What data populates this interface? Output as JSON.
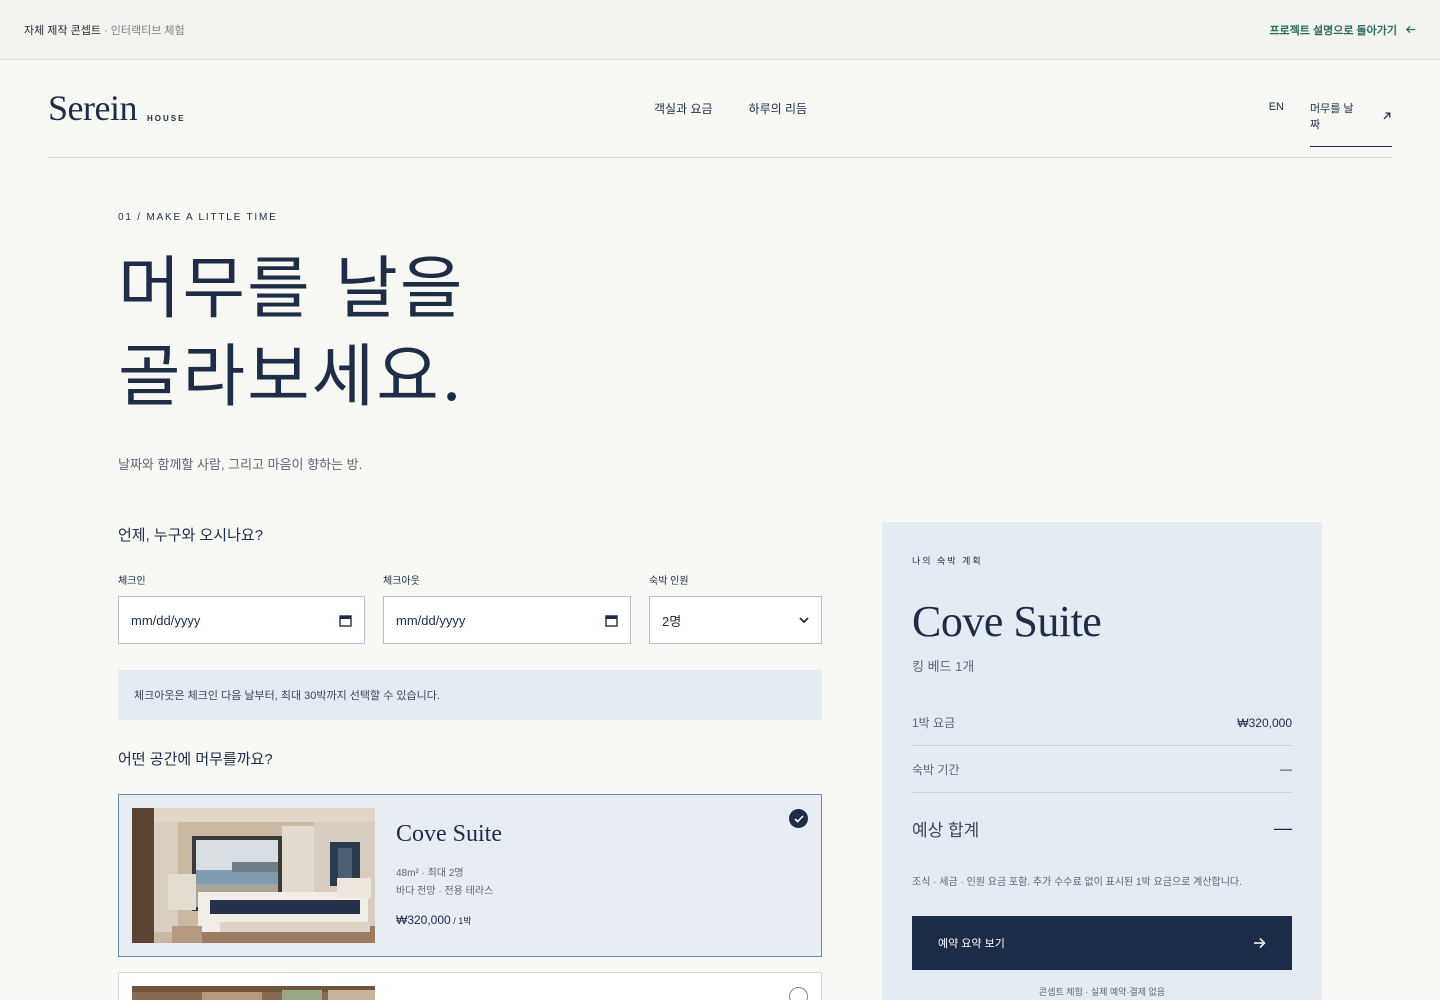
{
  "topbar": {
    "label_strong": "자체 제작 콘셉트",
    "label_muted": " · 인터랙티브 체험",
    "back_label": "프로젝트 설명으로 돌아가기"
  },
  "brand": {
    "name": "Serein",
    "sub": "HOUSE"
  },
  "nav": {
    "links": [
      "객실과 요금",
      "하루의 리듬"
    ],
    "lang": "EN",
    "cta": "머무를 날짜"
  },
  "hero": {
    "eyebrow": "01 / MAKE A LITTLE TIME",
    "line1": "머무를 날을",
    "line2": "골라보세요.",
    "subtitle": "날짜와 함께할 사람, 그리고 마음이 향하는 방."
  },
  "booking": {
    "question_when": "언제, 누구와 오시나요?",
    "checkin_label": "체크인",
    "checkin_value": "mm/dd/yyyy",
    "checkout_label": "체크아웃",
    "checkout_value": "mm/dd/yyyy",
    "guests_label": "숙박 인원",
    "guests_value": "2명",
    "notice": "체크아웃은 체크인 다음 날부터, 최대 30박까지 선택할 수 있습니다.",
    "question_room": "어떤 공간에 머무를까요?"
  },
  "rooms": [
    {
      "name": "Cove Suite",
      "meta1": "48m² · 최대 2명",
      "meta2": "바다 전망 · 전용 테라스",
      "price": "₩320,000",
      "unit": " / 1박",
      "selected": true
    }
  ],
  "summary": {
    "eyebrow": "나의 숙박 계획",
    "room": "Cove Suite",
    "bed": "킹 베드 1개",
    "rate_label": "1박 요금",
    "rate_value": "₩320,000",
    "nights_label": "숙박 기간",
    "nights_value": "—",
    "total_label": "예상 합계",
    "total_value": "—",
    "note": "조식 · 세금 · 인원 요금 포함. 추가 수수료 없이 표시된 1박 요금으로 계산합니다.",
    "button": "예약 요약 보기",
    "footer": "콘셉트 체험 · 실제 예약·결제 없음"
  },
  "colors": {
    "navy": "#1e2c44",
    "accent_green": "#2e6b5e",
    "panel": "#e4ebf2"
  }
}
